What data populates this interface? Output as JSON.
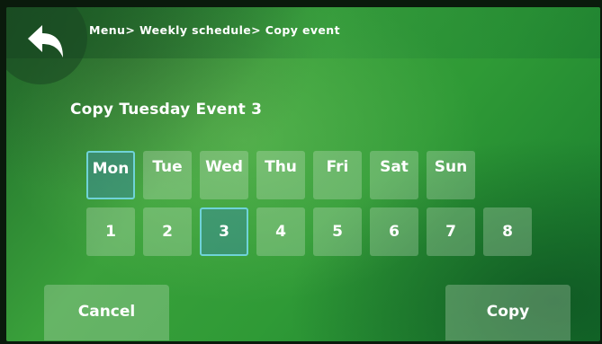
{
  "header": {
    "breadcrumb": "Menu> Weekly schedule> Copy event"
  },
  "page": {
    "title": "Copy Tuesday Event 3"
  },
  "days": [
    {
      "label": "Mon",
      "selected": true
    },
    {
      "label": "Tue",
      "selected": false
    },
    {
      "label": "Wed",
      "selected": false
    },
    {
      "label": "Thu",
      "selected": false
    },
    {
      "label": "Fri",
      "selected": false
    },
    {
      "label": "Sat",
      "selected": false
    },
    {
      "label": "Sun",
      "selected": false
    }
  ],
  "events": [
    {
      "label": "1",
      "selected": false
    },
    {
      "label": "2",
      "selected": false
    },
    {
      "label": "3",
      "selected": true
    },
    {
      "label": "4",
      "selected": false
    },
    {
      "label": "5",
      "selected": false
    },
    {
      "label": "6",
      "selected": false
    },
    {
      "label": "7",
      "selected": false
    },
    {
      "label": "8",
      "selected": false
    }
  ],
  "actions": {
    "cancel_label": "Cancel",
    "copy_label": "Copy"
  },
  "icons": {
    "back": "back-arrow-icon"
  },
  "colors": {
    "selected_border": "#6fd3d8"
  }
}
